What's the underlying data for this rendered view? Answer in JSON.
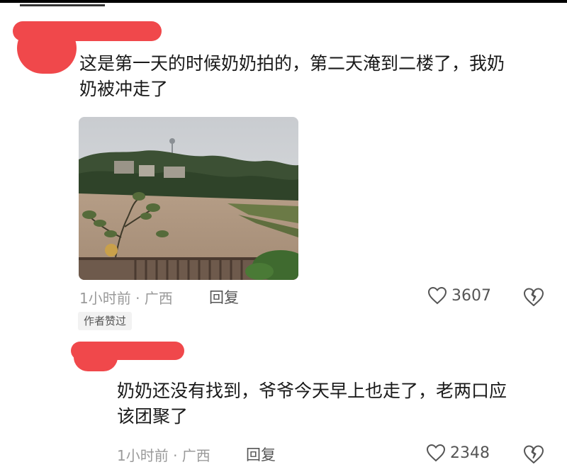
{
  "comments": [
    {
      "text": "这是第一天的时候奶奶拍的，第二天淹到二楼了，我奶\n奶被冲走了",
      "time_location": "1小时前 · 广西",
      "reply_label": "回复",
      "likes": "3607",
      "badge": "作者赞过"
    },
    {
      "text": "奶奶还没有找到，爷爷今天早上也走了，老两口应\n该团聚了",
      "time_location": "1小时前 · 广西",
      "reply_label": "回复",
      "likes": "2348"
    }
  ],
  "icons": {
    "like": "heart-outline-icon",
    "dislike": "broken-heart-icon"
  },
  "colors": {
    "redaction": "#f0484b",
    "meta_text": "#9a9a9a"
  }
}
